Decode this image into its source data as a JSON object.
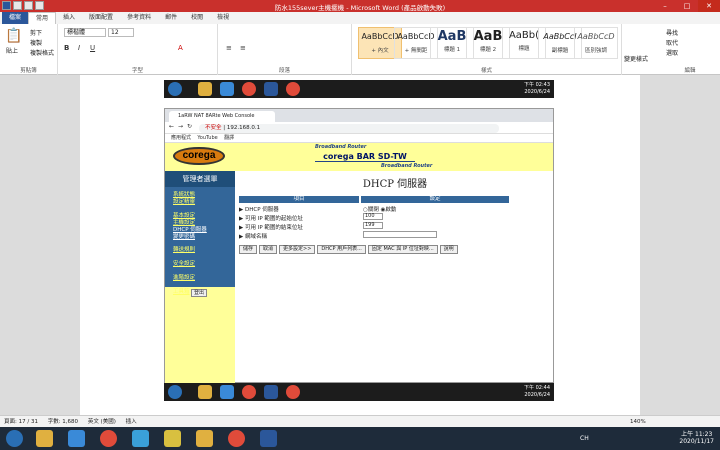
{
  "word": {
    "title": "防水155sever主機擺機 - Microsoft Word (產品啟動失敗)",
    "tabs": [
      "檔案",
      "常用",
      "插入",
      "版面配置",
      "參考資料",
      "郵件",
      "校閱",
      "檢視"
    ],
    "clipboard": {
      "paste": "貼上",
      "cut": "剪下",
      "copy": "複製",
      "format_painter": "複製格式",
      "label": "剪貼簿"
    },
    "font": {
      "name": "標楷體",
      "size": "12",
      "label": "字型"
    },
    "paragraph_label": "段落",
    "styles": [
      {
        "preview": "AaBbCcD",
        "name": "+ 內文"
      },
      {
        "preview": "AaBbCcD",
        "name": "+ 無間距"
      },
      {
        "preview": "AaB",
        "name": "標題 1"
      },
      {
        "preview": "AaB",
        "name": "標題 2"
      },
      {
        "preview": "AaBb(",
        "name": "標題"
      },
      {
        "preview": "AaBbCcI",
        "name": "副標題"
      },
      {
        "preview": "AaBbCcD",
        "name": "區別強調"
      }
    ],
    "styles_label": "樣式",
    "change_styles": "變更樣式",
    "editing": {
      "find": "尋找",
      "replace": "取代",
      "select": "選取",
      "label": "編輯"
    },
    "status": {
      "page": "頁面: 17 / 31",
      "words": "字數: 1,680",
      "lang": "英文 (美國)",
      "insert": "插入",
      "zoom": "140%"
    },
    "clock": {
      "time": "上午 11:23",
      "date": "2020/11/17"
    },
    "ime": "CH"
  },
  "screenshot": {
    "clock_top": {
      "time": "下午 02:43",
      "date": "2020/6/24"
    },
    "clock_bottom": {
      "time": "下午 02:44",
      "date": "2020/6/24"
    }
  },
  "browser": {
    "tab_title": "1aRW NAT 8ARte Web Console",
    "insecure": "不安全",
    "url": "192.168.0.1",
    "bookmarks": [
      "應用程式",
      "YouTube",
      "翻譯"
    ]
  },
  "router": {
    "logo": "corega",
    "brand_top": "Broadband Router",
    "brand_name": "corega BAR SD-TW",
    "brand_bottom": "Broadband Router",
    "admin_menu": "管理者選單",
    "menu": [
      "系統狀態",
      "設定精靈",
      "基本設定",
      "主機設定",
      "DHCP 伺服器",
      "變更密碼",
      "轉送規則",
      "安全設定",
      "進階設定",
      "工具箱"
    ],
    "logout": "登出",
    "page_title": "DHCP 伺服器",
    "col_item": "項目",
    "col_setting": "設定",
    "rows": [
      {
        "label": "DHCP 伺服器",
        "off": "關閉",
        "on": "啟動"
      },
      {
        "label": "可用 IP 範圍的起始位址",
        "value": "100"
      },
      {
        "label": "可用 IP 範圍的結束位址",
        "value": "199"
      },
      {
        "label": "網域名稱",
        "value": ""
      }
    ],
    "buttons": [
      "儲存",
      "取消",
      "更多設定>>",
      "DHCP 用戶列表...",
      "固定 MAC 與 IP 位址對映...",
      "說明"
    ]
  }
}
